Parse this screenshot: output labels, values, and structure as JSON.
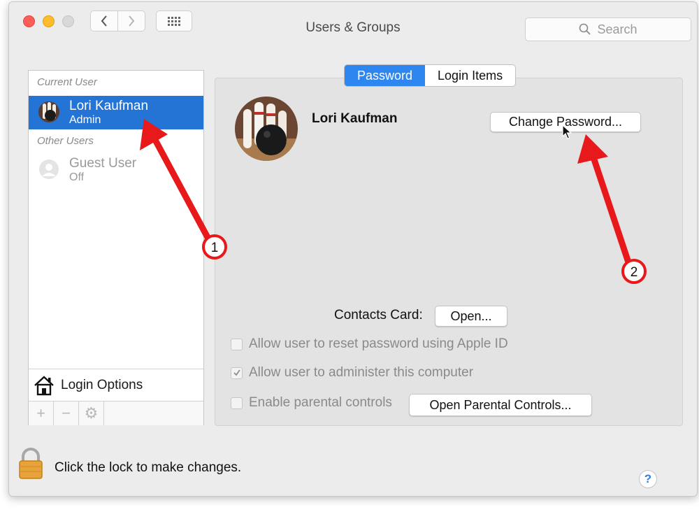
{
  "window": {
    "title": "Users & Groups",
    "search_placeholder": "Search"
  },
  "toolbar": {
    "back_icon": "chevron-left-icon",
    "forward_icon": "chevron-right-icon",
    "show_all_icon": "grid-icon"
  },
  "sidebar": {
    "current_user_label": "Current User",
    "other_users_label": "Other Users",
    "users": [
      {
        "name": "Lori Kaufman",
        "role": "Admin",
        "selected": true
      },
      {
        "name": "Guest User",
        "role": "Off",
        "selected": false
      }
    ],
    "login_options_label": "Login Options",
    "tools": [
      "+",
      "−",
      "⚙"
    ]
  },
  "tabs": [
    {
      "label": "Password",
      "active": true
    },
    {
      "label": "Login Items",
      "active": false
    }
  ],
  "detail": {
    "user_name": "Lori Kaufman",
    "change_password_label": "Change Password...",
    "contacts_card_label": "Contacts Card:",
    "open_label": "Open...",
    "options": [
      {
        "label": "Allow user to reset password using Apple ID",
        "checked": false
      },
      {
        "label": "Allow user to administer this computer",
        "checked": true
      },
      {
        "label": "Enable parental controls",
        "checked": false
      }
    ],
    "open_parental_label": "Open Parental Controls..."
  },
  "footer": {
    "lock_text": "Click the lock to make changes.",
    "help_label": "?"
  },
  "annotations": [
    {
      "label": "1"
    },
    {
      "label": "2"
    }
  ],
  "colors": {
    "selection": "#2474d6",
    "tab_active": "#2e86f0",
    "arrow": "#e8191b"
  }
}
